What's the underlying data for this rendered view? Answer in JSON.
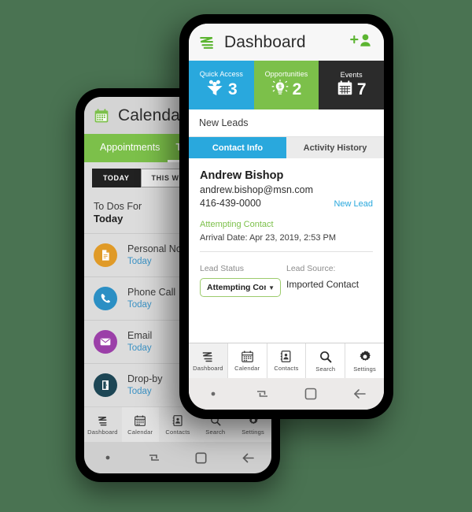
{
  "background_color": "#4a7352",
  "colors": {
    "blue": "#29a8dd",
    "green": "#7cc04a",
    "dark": "#2b2b2b",
    "link": "#3b92c4"
  },
  "front_phone": {
    "appbar": {
      "logo_icon": "zigzag-logo-icon",
      "title": "Dashboard",
      "add_icon": "add-person-icon"
    },
    "tiles": [
      {
        "caption": "Quick Access",
        "value": "3",
        "icon": "funnel-people-icon",
        "color": "#29a8dd"
      },
      {
        "caption": "Opportunities",
        "value": "2",
        "icon": "lightbulb-dollar-icon",
        "color": "#7cc04a"
      },
      {
        "caption": "Events",
        "value": "7",
        "icon": "calendar-icon",
        "color": "#2b2b2b"
      }
    ],
    "section_title": "New Leads",
    "tabs": [
      {
        "label": "Contact Info",
        "active": true
      },
      {
        "label": "Activity History",
        "active": false
      }
    ],
    "contact": {
      "name": "Andrew Bishop",
      "email": "andrew.bishop@msn.com",
      "phone": "416-439-0000",
      "badge": "New Lead",
      "status": "Attempting Contact",
      "arrival": "Arrival Date: Apr 23, 2019, 2:53 PM"
    },
    "lead": {
      "status_label": "Lead Status",
      "status_value": "Attempting Contac",
      "source_label": "Lead Source:",
      "source_value": "Imported Contact"
    },
    "bottom_nav": [
      {
        "label": "Dashboard",
        "icon": "zigzag-logo-icon",
        "active": true
      },
      {
        "label": "Calendar",
        "icon": "calendar-icon",
        "active": false
      },
      {
        "label": "Contacts",
        "icon": "contacts-book-icon",
        "active": false
      },
      {
        "label": "Search",
        "icon": "search-icon",
        "active": false
      },
      {
        "label": "Settings",
        "icon": "gear-icon",
        "active": false
      }
    ],
    "system_keys": [
      "dot-icon",
      "recent-apps-icon",
      "home-square-icon",
      "back-arrow-icon"
    ]
  },
  "back_phone": {
    "appbar": {
      "icon": "calendar-icon",
      "title": "Calendar"
    },
    "tabs": [
      {
        "label": "Appointments",
        "active": false
      },
      {
        "label": "To Dos",
        "active": true
      }
    ],
    "segments": [
      {
        "label": "TODAY",
        "active": true
      },
      {
        "label": "THIS WEEK",
        "active": false
      }
    ],
    "todo_header": {
      "line1": "To Dos For",
      "line2": "Today"
    },
    "todos": [
      {
        "name": "Personal Note",
        "due": "Today",
        "icon": "note-icon",
        "color": "#e09a27"
      },
      {
        "name": "Phone Call",
        "due": "Today",
        "icon": "phone-icon",
        "color": "#2b8fc4"
      },
      {
        "name": "Email",
        "due": "Today",
        "icon": "envelope-icon",
        "color": "#9b3fa8"
      },
      {
        "name": "Drop-by",
        "due": "Today",
        "icon": "door-icon",
        "color": "#1d4655"
      }
    ],
    "bottom_nav": [
      {
        "label": "Dashboard",
        "icon": "zigzag-logo-icon",
        "active": false
      },
      {
        "label": "Calendar",
        "icon": "calendar-icon",
        "active": true
      },
      {
        "label": "Contacts",
        "icon": "contacts-book-icon",
        "active": false
      },
      {
        "label": "Search",
        "icon": "search-icon",
        "active": false
      },
      {
        "label": "Settings",
        "icon": "gear-icon",
        "active": false
      }
    ],
    "system_keys": [
      "dot-icon",
      "recent-apps-icon",
      "home-square-icon",
      "back-arrow-icon"
    ]
  }
}
